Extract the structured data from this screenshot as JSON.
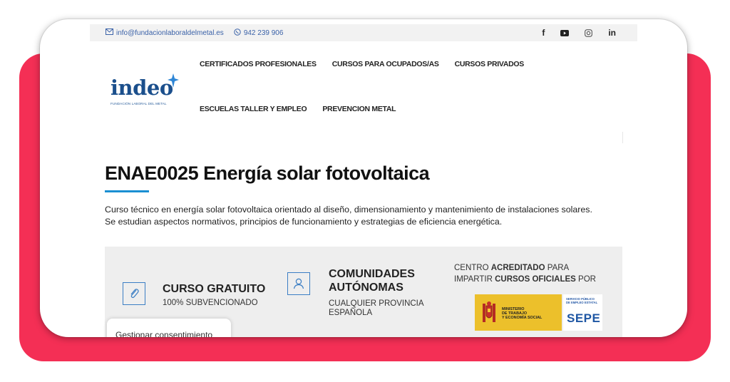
{
  "topbar": {
    "email": "info@fundacionlaboraldelmetal.es",
    "phone": "942 239 906",
    "social": [
      "f",
      "▶",
      "◎",
      "in"
    ]
  },
  "logo": {
    "word": "indeo",
    "sub": "FUNDACIÓN LABORAL DEL METAL"
  },
  "nav": {
    "row1": [
      "CERTIFICADOS PROFESIONALES",
      "CURSOS PARA OCUPADOS/AS",
      "CURSOS PRIVADOS"
    ],
    "row2": [
      "ESCUELAS TALLER Y EMPLEO",
      "PREVENCION METAL"
    ]
  },
  "page": {
    "title": "ENAE0025 Energía solar fotovoltaica",
    "description": "Curso técnico en energía solar fotovoltaica orientado al diseño, dimensionamiento y mantenimiento de instalaciones solares. Se estudian aspectos normativos, principios de funcionamiento y estrategias de eficiencia energética."
  },
  "features": {
    "gratuito": {
      "title": "CURSO GRATUITO",
      "sub": "100% SUBVENCIONADO"
    },
    "comunidades": {
      "title1": "COMUNIDADES",
      "title2": "AUTÓNOMAS",
      "sub1": "CUALQUIER PROVINCIA",
      "sub2": "ESPAÑOLA"
    },
    "centro": {
      "pre1": "CENTRO ",
      "bold1": "ACREDITADO",
      "post1": " PARA",
      "pre2": "IMPARTIR ",
      "bold2": "CURSOS OFICIALES",
      "post2": " POR"
    },
    "ministerio": {
      "line1": "MINISTERIO",
      "line2": "DE TRABAJO",
      "line3": "Y ECONOMÍA SOCIAL"
    },
    "sepe": {
      "small1": "SERVICIO PÚBLICO",
      "small2": "DE EMPLEO ESTATAL",
      "big": "SEPE"
    }
  },
  "consent": {
    "label": "Gestionar consentimiento"
  },
  "colors": {
    "accent_red": "#f42f55",
    "brand_blue": "#1b4f8c",
    "underline_blue": "#1a8fd2",
    "ministerio_yellow": "#ecc02b"
  }
}
